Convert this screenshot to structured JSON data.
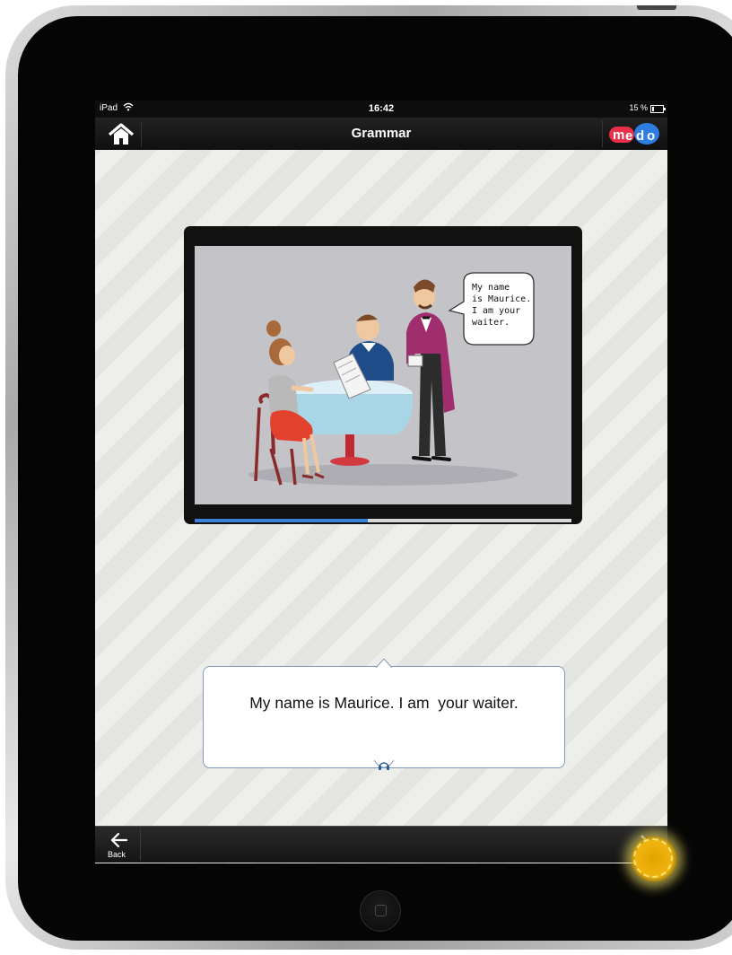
{
  "status_bar": {
    "carrier": "iPad",
    "time": "16:42",
    "battery": "15 %"
  },
  "nav": {
    "title": "Grammar",
    "home_icon": "house-icon",
    "logo_letters": [
      "m",
      "e",
      "d",
      "o"
    ]
  },
  "video": {
    "speech_bubble_text": [
      "My name",
      "is Maurice.",
      "I am your",
      "waiter."
    ],
    "progress_percent": 46
  },
  "caption": {
    "text": "My name is Maurice. I am  your waiter."
  },
  "toolbar": {
    "back_label": "Back",
    "back_icon": "arrow-left-icon",
    "next_icon": "chevron-right-icon"
  },
  "colors": {
    "progress": "#3a7fd8",
    "tap_indicator": "#f0b410",
    "logo_red": "#e8304a",
    "logo_blue": "#2e7de0"
  }
}
